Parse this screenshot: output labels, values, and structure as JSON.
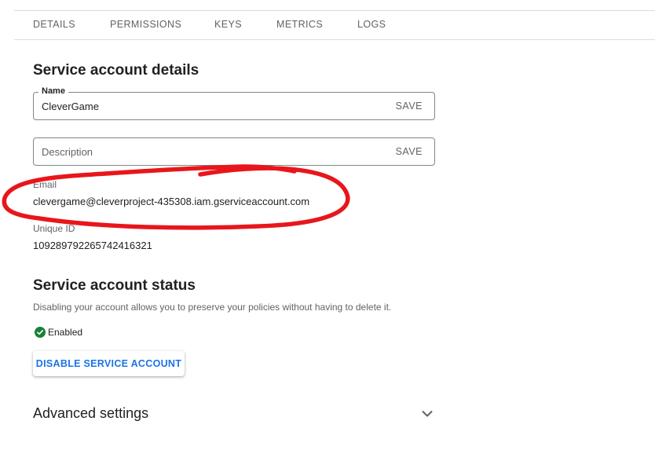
{
  "tabs": [
    {
      "label": "DETAILS"
    },
    {
      "label": "PERMISSIONS"
    },
    {
      "label": "KEYS"
    },
    {
      "label": "METRICS"
    },
    {
      "label": "LOGS"
    }
  ],
  "details": {
    "title": "Service account details",
    "name_field": {
      "label": "Name",
      "value": "CleverGame",
      "save_label": "SAVE"
    },
    "description_field": {
      "placeholder": "Description",
      "save_label": "SAVE"
    },
    "email": {
      "label": "Email",
      "value": "clevergame@cleverproject-435308.iam.gserviceaccount.com"
    },
    "unique_id": {
      "label": "Unique ID",
      "value": "109289792265742416321"
    }
  },
  "status": {
    "title": "Service account status",
    "description": "Disabling your account allows you to preserve your policies without having to delete it.",
    "state": "Enabled",
    "state_icon": "check-circle-icon",
    "state_color": "#188038",
    "disable_button": "DISABLE SERVICE ACCOUNT"
  },
  "advanced": {
    "title": "Advanced settings",
    "icon": "chevron-down-icon"
  },
  "annotation": {
    "color": "#e8161b",
    "shape": "freehand-ellipse-around-email"
  },
  "colors": {
    "accent": "#1a73e8",
    "text": "#202124",
    "muted": "#5f6368",
    "border": "#dadce0"
  }
}
